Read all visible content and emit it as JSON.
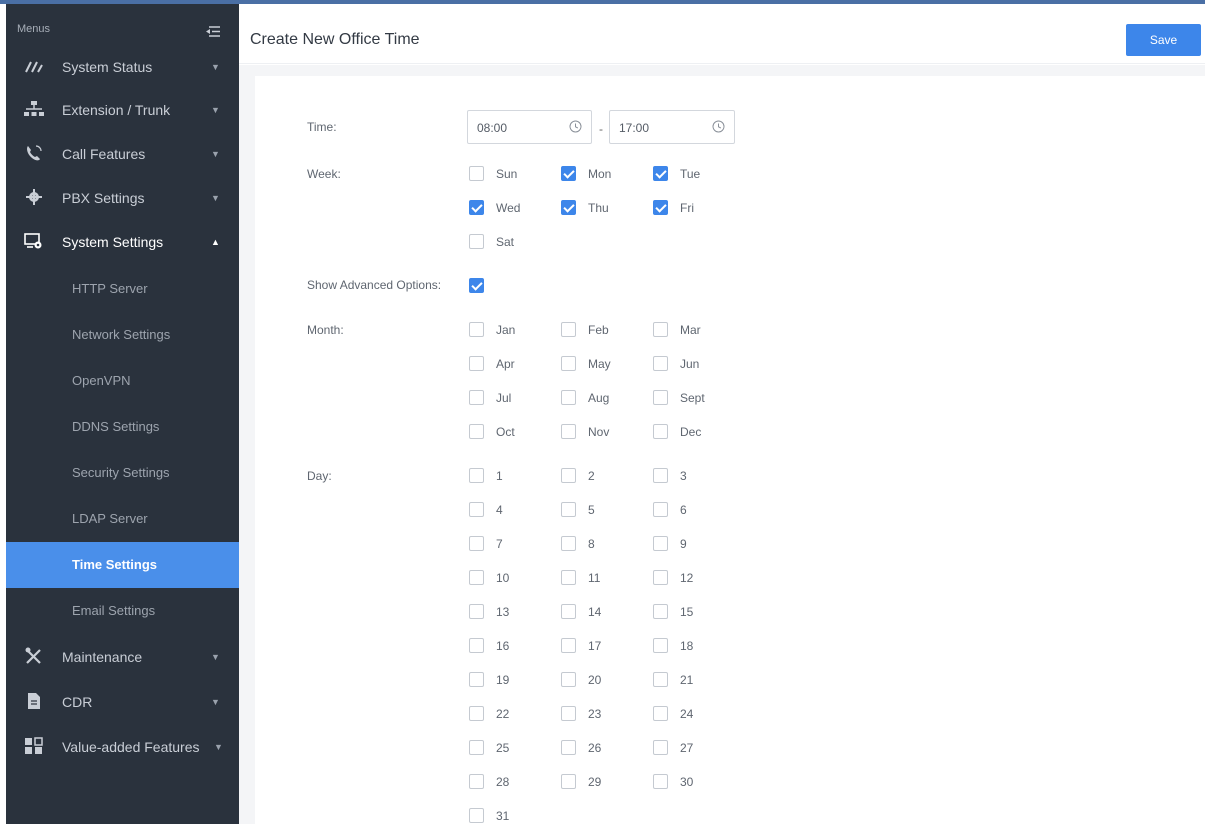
{
  "sidebar": {
    "menus_label": "Menus",
    "items": [
      {
        "label": "System Status",
        "icon": "gauge-icon"
      },
      {
        "label": "Extension / Trunk",
        "icon": "network-icon"
      },
      {
        "label": "Call Features",
        "icon": "phone-icon"
      },
      {
        "label": "PBX Settings",
        "icon": "gear-icon"
      },
      {
        "label": "System Settings",
        "icon": "settings-screen-icon",
        "open": true
      },
      {
        "label": "Maintenance",
        "icon": "tools-icon"
      },
      {
        "label": "CDR",
        "icon": "document-icon"
      },
      {
        "label": "Value-added Features",
        "icon": "grid-icon"
      }
    ],
    "sub_items": [
      {
        "label": "HTTP Server"
      },
      {
        "label": "Network Settings"
      },
      {
        "label": "OpenVPN"
      },
      {
        "label": "DDNS Settings"
      },
      {
        "label": "Security Settings"
      },
      {
        "label": "LDAP Server"
      },
      {
        "label": "Time Settings",
        "active": true
      },
      {
        "label": "Email Settings"
      }
    ]
  },
  "header": {
    "title": "Create New Office Time",
    "save_label": "Save"
  },
  "form": {
    "time_label": "Time:",
    "start_time": "08:00",
    "end_time": "17:00",
    "time_separator": "-",
    "week_label": "Week:",
    "week": [
      {
        "label": "Sun",
        "checked": false
      },
      {
        "label": "Mon",
        "checked": true
      },
      {
        "label": "Tue",
        "checked": true
      },
      {
        "label": "Wed",
        "checked": true
      },
      {
        "label": "Thu",
        "checked": true
      },
      {
        "label": "Fri",
        "checked": true
      },
      {
        "label": "Sat",
        "checked": false
      }
    ],
    "advanced_label": "Show Advanced Options:",
    "advanced_checked": true,
    "month_label": "Month:",
    "months": [
      "Jan",
      "Feb",
      "Mar",
      "Apr",
      "May",
      "Jun",
      "Jul",
      "Aug",
      "Sept",
      "Oct",
      "Nov",
      "Dec"
    ],
    "day_label": "Day:",
    "days": [
      "1",
      "2",
      "3",
      "4",
      "5",
      "6",
      "7",
      "8",
      "9",
      "10",
      "11",
      "12",
      "13",
      "14",
      "15",
      "16",
      "17",
      "18",
      "19",
      "20",
      "21",
      "22",
      "23",
      "24",
      "25",
      "26",
      "27",
      "28",
      "29",
      "30",
      "31"
    ]
  },
  "colors": {
    "sidebar_bg": "#2a323d",
    "active_bg": "#4a8fea",
    "accent": "#3d86ea"
  }
}
